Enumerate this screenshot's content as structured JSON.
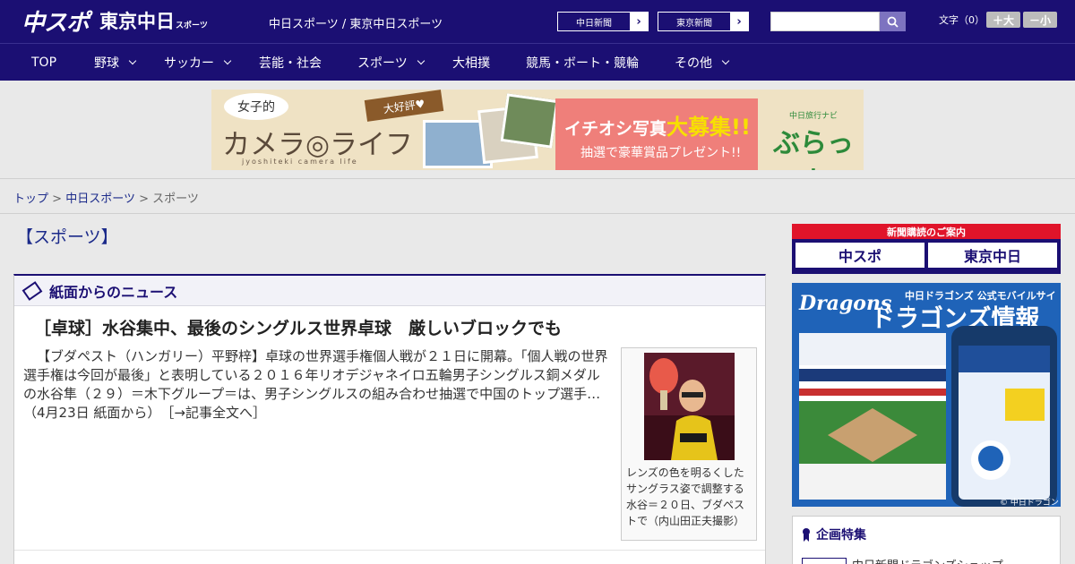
{
  "header": {
    "logo_main": "中スポ",
    "logo_tokyo": "東京中日",
    "logo_tokyo_suffix": "スポーツ",
    "site_title": "中日スポーツ / 東京中日スポーツ",
    "paper_buttons": [
      "中日新聞",
      "東京新聞"
    ],
    "search_placeholder": "",
    "font_size_label": "文字（0）",
    "font_bigger": "＋大",
    "font_smaller": "－小"
  },
  "nav": {
    "items": [
      {
        "label": "TOP",
        "dropdown": false
      },
      {
        "label": "野球",
        "dropdown": true
      },
      {
        "label": "サッカー",
        "dropdown": true
      },
      {
        "label": "芸能・社会",
        "dropdown": false
      },
      {
        "label": "スポーツ",
        "dropdown": true
      },
      {
        "label": "大相撲",
        "dropdown": false
      },
      {
        "label": "競馬・ボート・競輪",
        "dropdown": false
      },
      {
        "label": "その他",
        "dropdown": true
      }
    ]
  },
  "banner": {
    "bubble": "女子的",
    "title": "カメラ◎ライフ",
    "subtitle": "jyoshiteki camera life",
    "tag": "大好評♥",
    "promo_line1_pre": "イチオシ写真",
    "promo_line1_big": "大募集!!",
    "promo_line2": "抽選で豪華賞品プレゼント!!",
    "brand_small": "中日旅行ナビ",
    "brand_name": "ぶらっ人"
  },
  "breadcrumb": {
    "home": "トップ",
    "parent": "中日スポーツ",
    "current": "スポーツ",
    "separator": ">"
  },
  "page_title": "【スポーツ】",
  "news": {
    "section_title": "紙面からのニュース",
    "headline": "［卓球］水谷集中、最後のシングルス世界卓球　厳しいブロックでも",
    "body": "【ブダペスト（ハンガリー）平野梓】卓球の世界選手権個人戦が２１日に開幕。「個人戦の世界選手権は今回が最後」と表明している２０１６年リオデジャネイロ五輪男子シングルス銅メダルの水谷隼（２９）＝木下グループ＝は、男子シングルスの組み合わせ抽選で中国のトップ選手…（4月23日 紙面から）",
    "more_link": "［→記事全文へ］",
    "photo_caption": "レンズの色を明るくしたサングラス姿で調整する水谷＝２０日、ブダペストで（内山田正夫撮影）"
  },
  "sidebar": {
    "subscription_title": "新聞購読のご案内",
    "subscription_buttons": [
      "中スポ",
      "東京中日"
    ],
    "dragons_logo": "Dragons",
    "dragons_tagline": "中日ドラゴンズ 公式モバイルサイト",
    "dragons_title": "ドラゴンズ情報",
    "dragons_copyright": "© 中日ドラゴンズ",
    "feature_title": "企画特集",
    "feature_item": "中日新聞ドラゴンズショップ"
  }
}
